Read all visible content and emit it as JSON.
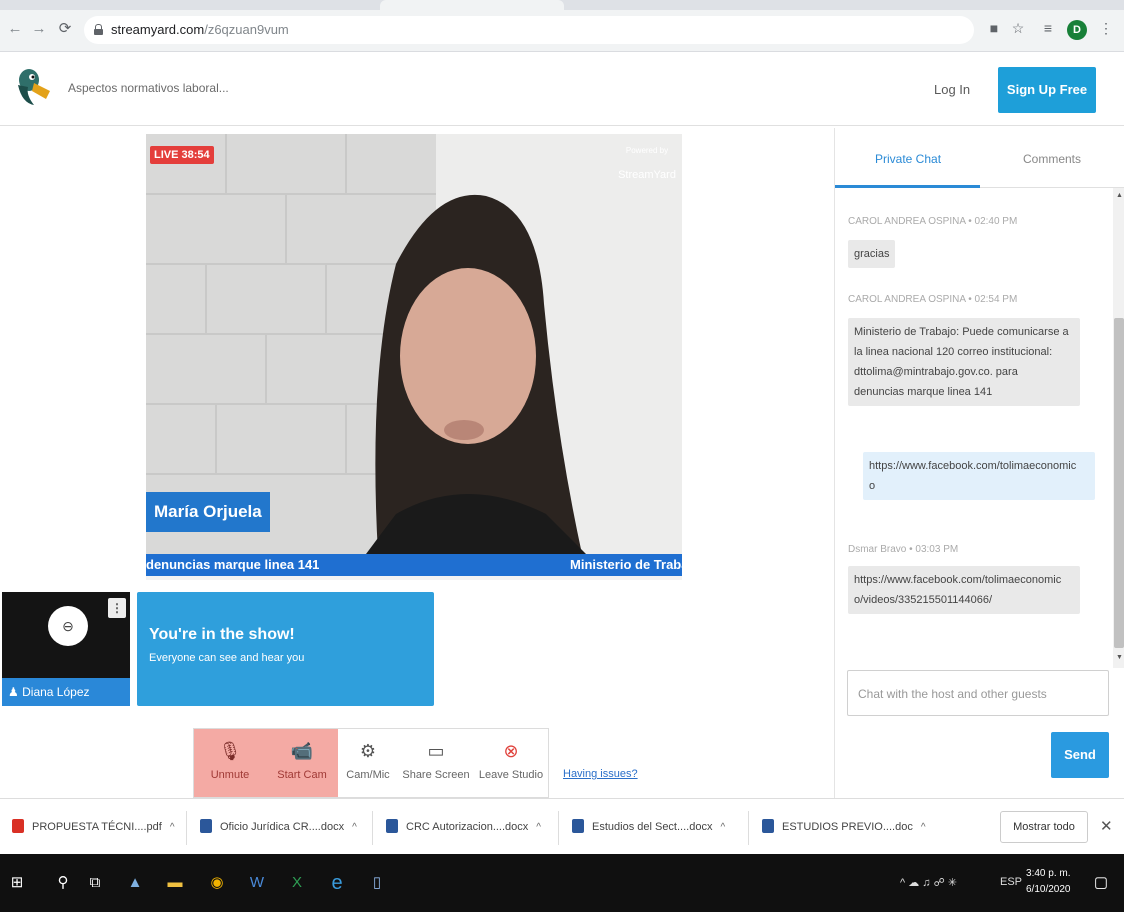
{
  "browser": {
    "url_host": "streamyard.com",
    "url_path": "/z6qzuan9vum"
  },
  "header": {
    "broadcast_title": "Aspectos normativos laboral...",
    "login_label": "Log In",
    "signup_label": "Sign Up Free"
  },
  "stage": {
    "live_label": "LIVE 38:54",
    "powered_by": "Powered by",
    "brand": "StreamYard",
    "presenter_name": "María Orjuela",
    "ticker_left": "denuncias marque linea 141",
    "ticker_right": "Ministerio de Traba"
  },
  "guest": {
    "name": "Diana López",
    "menu_glyph": "⋮"
  },
  "inshow": {
    "title": "You're in the show!",
    "subtitle": "Everyone can see and hear you"
  },
  "toolbar": {
    "unmute_label": "Unmute",
    "startcam_label": "Start Cam",
    "cammic_label": "Cam/Mic",
    "sharescreen_label": "Share Screen",
    "leave_label": "Leave Studio",
    "having_issues": "Having issues?"
  },
  "chat": {
    "tab_private": "Private Chat",
    "tab_comments": "Comments",
    "messages": [
      {
        "meta": "CAROL ANDREA OSPINA • 02:40 PM",
        "text": "gracias"
      },
      {
        "meta": "CAROL ANDREA OSPINA • 02:54 PM",
        "lines": [
          "Ministerio de Trabajo: Puede comunicarse a",
          "la linea nacional 120 correo institucional:",
          "dttolima@mintrabajo.gov.co. para",
          "denuncias marque linea 141"
        ]
      },
      {
        "meta": "",
        "lines": [
          "https://www.facebook.com/tolimaeconomic",
          "o"
        ]
      },
      {
        "meta": "Dsmar Bravo • 03:03 PM",
        "lines": [
          "https://www.facebook.com/tolimaeconomic",
          "o/videos/335215501144066/"
        ]
      }
    ],
    "input_placeholder": "Chat with the host and other guests",
    "send_label": "Send"
  },
  "downloads": {
    "items": [
      {
        "name": "PROPUESTA TÉCNI....pdf",
        "type": "pdf"
      },
      {
        "name": "Oficio Jurídica CR....docx",
        "type": "docx"
      },
      {
        "name": "CRC Autorizacion....docx",
        "type": "docx"
      },
      {
        "name": "Estudios del Sect....docx",
        "type": "docx"
      },
      {
        "name": "ESTUDIOS PREVIO....doc",
        "type": "doc"
      }
    ],
    "show_all_label": "Mostrar todo"
  },
  "taskbar": {
    "lang": "ESP",
    "time": "3:40 p. m.",
    "date": "6/10/2020"
  },
  "colors": {
    "brand_blue": "#1e9fd9",
    "live_red": "#e43e3b",
    "muted_red": "#f4aaa4"
  }
}
